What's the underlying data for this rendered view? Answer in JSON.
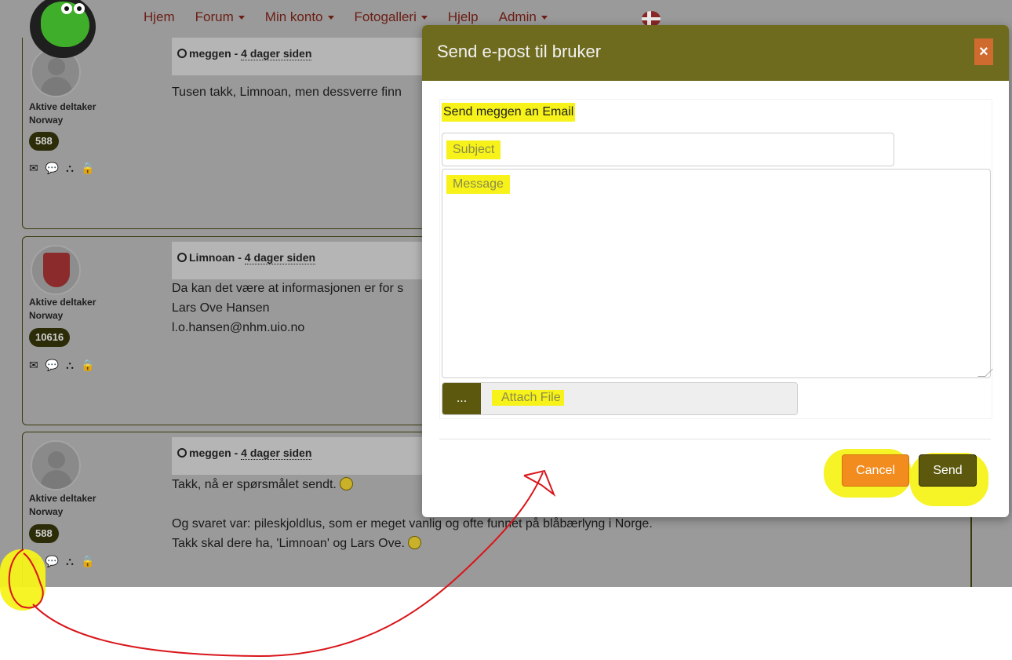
{
  "nav": {
    "items": [
      {
        "label": "Hjem",
        "dropdown": false
      },
      {
        "label": "Forum",
        "dropdown": true
      },
      {
        "label": "Min konto",
        "dropdown": true
      },
      {
        "label": "Fotogalleri",
        "dropdown": true
      },
      {
        "label": "Hjelp",
        "dropdown": false
      },
      {
        "label": "Admin",
        "dropdown": true
      }
    ],
    "flag_icon": "norway-flag-icon"
  },
  "posts": [
    {
      "author": "meggen",
      "time": "4 dager siden",
      "rank": "Aktive deltaker",
      "country": "Norway",
      "post_count": "588",
      "lines": [
        "Tusen takk, Limnoan, men dessverre finn"
      ]
    },
    {
      "author": "Limnoan",
      "time": "4 dager siden",
      "rank": "Aktive deltaker",
      "country": "Norway",
      "post_count": "10616",
      "lines": [
        "Da kan det være at informasjonen er for s",
        "Lars Ove Hansen",
        "l.o.hansen@nhm.uio.no"
      ]
    },
    {
      "author": "meggen",
      "time": "4 dager siden",
      "rank": "Aktive deltaker",
      "country": "Norway",
      "post_count": "588",
      "lines": [
        "Takk, nå er spørsmålet sendt.",
        "",
        "Og svaret var: pileskjoldlus, som er meget vanlig og ofte funnet på blåbærlyng i Norge.",
        "Takk skal dere ha, 'Limnoan' og Lars Ove."
      ]
    }
  ],
  "post_separator": "-",
  "modal": {
    "title": "Send e-post til bruker",
    "close_label": "×",
    "form_label": "Send meggen an Email",
    "subject_placeholder": "Subject",
    "message_placeholder": "Message",
    "browse_label": "...",
    "attach_placeholder": "Attach File",
    "cancel_label": "Cancel",
    "send_label": "Send"
  },
  "colors": {
    "modal_header": "#6e6b1e",
    "send_button": "#5c590f",
    "cancel_button": "#f28c1e",
    "highlight": "#f6f21a",
    "annotation_arrow": "#d9161b"
  }
}
